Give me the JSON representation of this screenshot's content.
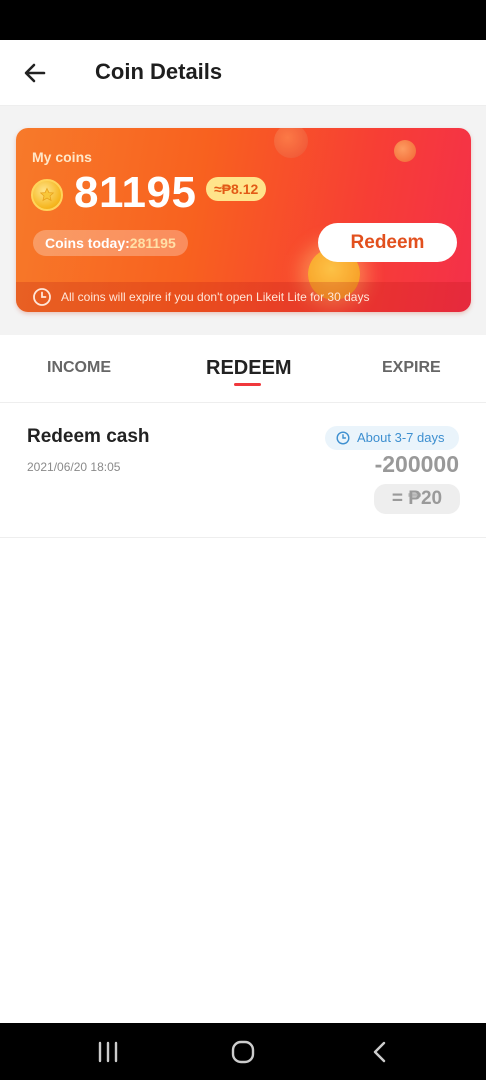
{
  "header": {
    "title": "Coin Details",
    "back_icon": "arrow-left-icon"
  },
  "coin_card": {
    "label": "My coins",
    "balance": "81195",
    "peso_equivalent": "≈₱8.12",
    "today_label": "Coins today:",
    "today_value": "281195",
    "redeem_label": "Redeem",
    "expire_notice": "All coins will expire if you don't open Likeit Lite for 30 days",
    "colors": {
      "gradient_start": "#f77a2a",
      "gradient_end": "#f4304a",
      "accent": "#e2501e"
    }
  },
  "tabs": [
    {
      "label": "INCOME",
      "active": false
    },
    {
      "label": "REDEEM",
      "active": true
    },
    {
      "label": "EXPIRE",
      "active": false
    }
  ],
  "records": [
    {
      "title": "Redeem cash",
      "date": "2021/06/20 18:05",
      "eta": "About 3-7 days",
      "amount": "-200000",
      "cash": "= ₱20"
    }
  ],
  "nav": {
    "recents_icon": "recents-icon",
    "home_icon": "home-icon",
    "back_icon": "back-icon"
  }
}
